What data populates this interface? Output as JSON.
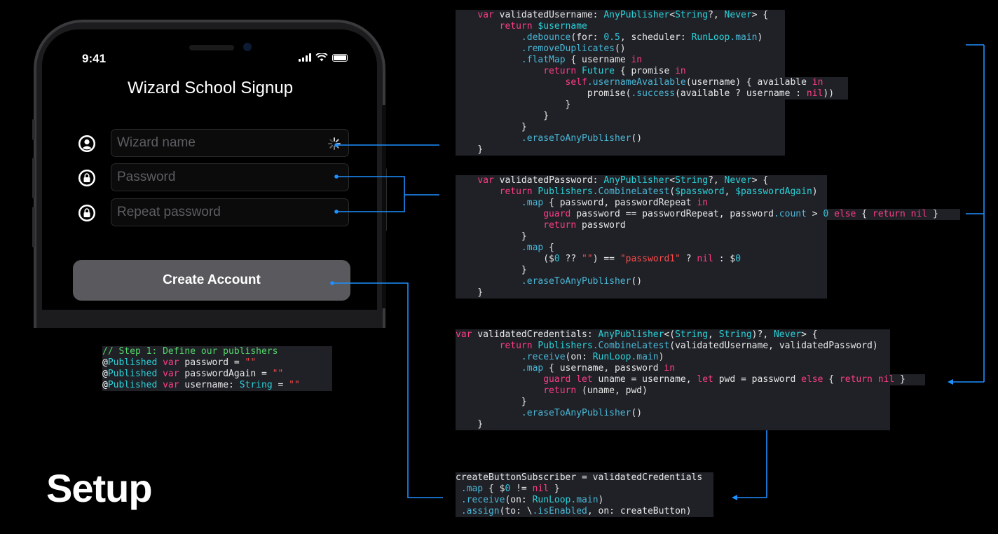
{
  "slide_title": "Setup",
  "phone": {
    "time": "9:41",
    "app_title": "Wizard School Signup",
    "fields": [
      {
        "placeholder": "Wizard name",
        "icon": "person-icon"
      },
      {
        "placeholder": "Password",
        "icon": "lock-icon"
      },
      {
        "placeholder": "Repeat password",
        "icon": "lock-icon"
      }
    ],
    "create_button_label": "Create Account"
  },
  "colors": {
    "accent": "#1e90ff",
    "keyword": "#ff3d86",
    "type": "#2ad2d9",
    "string": "#ff4b4b",
    "comment": "#55d66b"
  },
  "code": {
    "publishers": [
      "// Step 1: Define our publishers",
      "@Published var password = \"\"",
      "@Published var passwordAgain = \"\"",
      "@Published var username: String = \"\""
    ],
    "validated_username": [
      "    var validatedUsername: AnyPublisher<String?, Never> {",
      "        return $username",
      "            .debounce(for: 0.5, scheduler: RunLoop.main)",
      "            .removeDuplicates()",
      "            .flatMap { username in",
      "                return Future { promise in",
      "                    self.usernameAvailable(username) { available in",
      "                        promise(.success(available ? username : nil))",
      "                    }",
      "                }",
      "            }",
      "            .eraseToAnyPublisher()",
      "    }"
    ],
    "validated_password": [
      "    var validatedPassword: AnyPublisher<String?, Never> {",
      "        return Publishers.CombineLatest($password, $passwordAgain)",
      "            .map { password, passwordRepeat in",
      "                guard password == passwordRepeat, password.count > 0 else { return nil }",
      "                return password",
      "            }",
      "            .map {",
      "                ($0 ?? \"\") == \"password1\" ? nil : $0",
      "            }",
      "            .eraseToAnyPublisher()",
      "    }"
    ],
    "validated_credentials": [
      "var validatedCredentials: AnyPublisher<(String, String)?, Never> {",
      "        return Publishers.CombineLatest(validatedUsername, validatedPassword)",
      "            .receive(on: RunLoop.main)",
      "            .map { username, password in",
      "                guard let uname = username, let pwd = password else { return nil }",
      "                return (uname, pwd)",
      "            }",
      "            .eraseToAnyPublisher()",
      "    }"
    ],
    "create_button_subscriber": [
      "createButtonSubscriber = validatedCredentials",
      " .map { $0 != nil }",
      " .receive(on: RunLoop.main)",
      " .assign(to: \\.isEnabled, on: createButton)"
    ]
  }
}
